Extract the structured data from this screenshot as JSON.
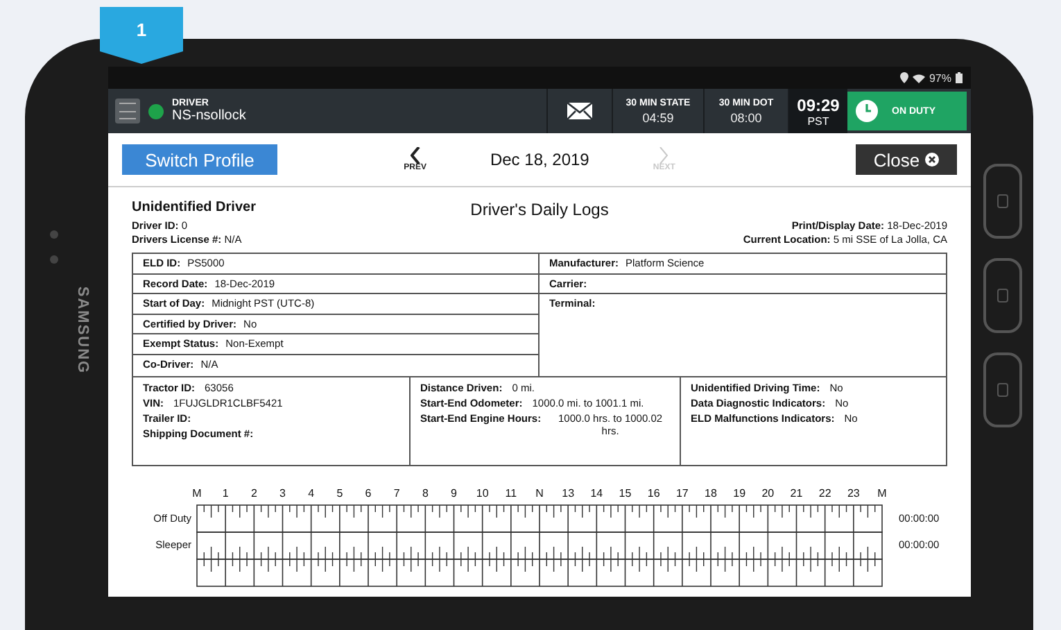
{
  "callout": {
    "label": "1"
  },
  "device": {
    "brand": "SAMSUNG"
  },
  "status_bar": {
    "battery": "97%"
  },
  "top_bar": {
    "driver_label": "DRIVER",
    "driver_name": "NS-nsollock",
    "timers": [
      {
        "label": "30 MIN STATE",
        "value": "04:59"
      },
      {
        "label": "30 MIN DOT",
        "value": "08:00"
      }
    ],
    "clock": {
      "time": "09:29",
      "zone": "PST"
    },
    "duty_status": "ON DUTY"
  },
  "toolbar": {
    "switch_button": "Switch Profile",
    "prev": {
      "label": "PREV",
      "disabled": false
    },
    "date": "Dec 18, 2019",
    "next": {
      "label": "NEXT",
      "disabled": true
    },
    "close_button": "Close"
  },
  "log": {
    "title": "Driver's Daily Logs",
    "driver": "Unidentified Driver",
    "left_info": [
      {
        "label": "Driver ID:",
        "value": "0"
      },
      {
        "label": "Drivers License #:",
        "value": "N/A"
      }
    ],
    "right_info": [
      {
        "label": "Print/Display Date:",
        "value": "18-Dec-2019"
      },
      {
        "label": "Current Location:",
        "value": "5 mi SSE of La Jolla, CA"
      }
    ],
    "eld_rows": [
      {
        "label": "ELD ID:",
        "value": "PS5000"
      },
      {
        "label": "Record Date:",
        "value": "18-Dec-2019"
      },
      {
        "label": "Start of Day:",
        "value": "Midnight PST (UTC-8)"
      },
      {
        "label": "Certified by Driver:",
        "value": "No"
      },
      {
        "label": "Exempt Status:",
        "value": "Non-Exempt"
      },
      {
        "label": "Co-Driver:",
        "value": "N/A"
      }
    ],
    "company_rows": [
      {
        "label": "Manufacturer:",
        "value": "Platform Science"
      },
      {
        "label": "Carrier:"
      },
      {
        "label": "Terminal:"
      }
    ],
    "vehicle": [
      {
        "label": "Tractor ID:",
        "value": "63056"
      },
      {
        "label": "VIN:",
        "value": "1FUJGLDR1CLBF5421"
      },
      {
        "label": "Trailer ID:"
      },
      {
        "label": "Shipping Document #:"
      }
    ],
    "trip": [
      {
        "label": "Distance Driven:",
        "value": "0 mi."
      },
      {
        "label": "Start-End Odometer:",
        "value": "1000.0 mi. to 1001.1 mi."
      },
      {
        "label": "Start-End Engine Hours:",
        "value": "1000.0 hrs. to 1000.02 hrs."
      }
    ],
    "indicators": [
      {
        "label": "Unidentified Driving Time:",
        "value": "No"
      },
      {
        "label": "Data Diagnostic Indicators:",
        "value": "No"
      },
      {
        "label": "ELD Malfunctions Indicators:",
        "value": "No"
      }
    ],
    "graph": {
      "hours": [
        "M",
        "1",
        "2",
        "3",
        "4",
        "5",
        "6",
        "7",
        "8",
        "9",
        "10",
        "11",
        "N",
        "13",
        "14",
        "15",
        "16",
        "17",
        "18",
        "19",
        "20",
        "21",
        "22",
        "23",
        "M"
      ],
      "rows": [
        {
          "label": "Off Duty",
          "total": "00:00:00"
        },
        {
          "label": "Sleeper",
          "total": "00:00:00"
        }
      ]
    }
  }
}
